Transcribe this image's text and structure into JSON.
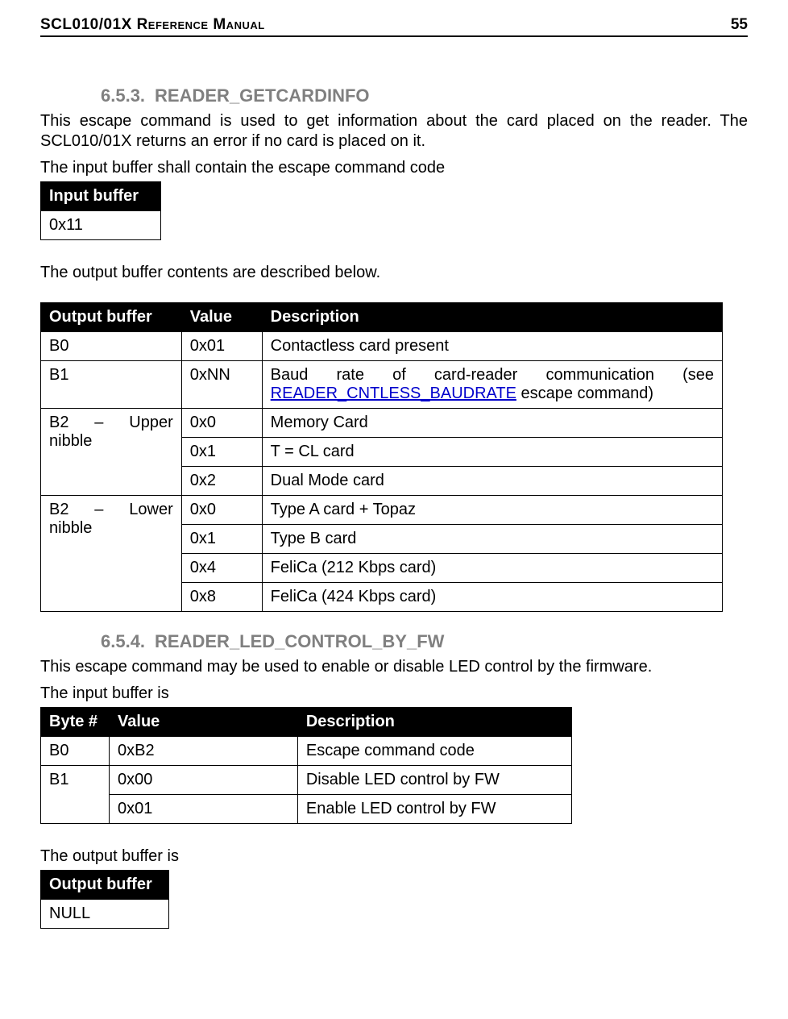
{
  "header": {
    "title": "SCL010/01X Reference Manual",
    "page": "55"
  },
  "sections": [
    {
      "num": "6.5.3.",
      "title": "READER_GETCARDINFO",
      "p1a": "This escape command is used to get information about the card placed on the reader. The",
      "p1b": "SCL010/01X returns an error if no card is placed on it.",
      "p2": "The input buffer shall contain the escape command code",
      "input_table": {
        "header": "Input buffer",
        "cell": "0x11"
      },
      "p3": "The output buffer contents are described below.",
      "output_table": {
        "headers": [
          "Output buffer",
          "Value",
          "Description"
        ],
        "rows": {
          "b0": {
            "c1": "B0",
            "c2": "0x01",
            "c3": "Contactless card present"
          },
          "b1": {
            "c1": "B1",
            "c2": "0xNN",
            "c3a": "Baud rate of card-reader communication (see",
            "c3link": "READER_CNTLESS_BAUDRATE",
            "c3b": " escape command)"
          },
          "b2u": {
            "c1": "B2 – Upper nibble",
            "r0": {
              "c2": "0x0",
              "c3": "Memory Card"
            },
            "r1": {
              "c2": "0x1",
              "c3": "T = CL card"
            },
            "r2": {
              "c2": "0x2",
              "c3": "Dual Mode card"
            }
          },
          "b2l": {
            "c1": "B2 – Lower nibble",
            "r0": {
              "c2": "0x0",
              "c3": "Type A card + Topaz"
            },
            "r1": {
              "c2": "0x1",
              "c3": "Type B card"
            },
            "r4": {
              "c2": "0x4",
              "c3": "FeliCa (212 Kbps card)"
            },
            "r8": {
              "c2": "0x8",
              "c3": "FeliCa (424 Kbps card)"
            }
          }
        }
      }
    },
    {
      "num": "6.5.4.",
      "title": "READER_LED_CONTROL_BY_FW",
      "p1": "This escape command may be used to enable or disable LED control by the firmware.",
      "p2": "The input buffer is",
      "led_table": {
        "headers": [
          "Byte #",
          "Value",
          "Description"
        ],
        "rows": {
          "b0": {
            "c1": "B0",
            "c2": "0xB2",
            "c3": "Escape command code"
          },
          "b1": {
            "c1": "B1",
            "r0": {
              "c2": "0x00",
              "c3": "Disable LED control by FW"
            },
            "r1": {
              "c2": "0x01",
              "c3": "Enable LED control by FW"
            }
          }
        }
      },
      "p3": "The output buffer is",
      "outnull_table": {
        "header": "Output buffer",
        "cell": "NULL"
      }
    }
  ]
}
